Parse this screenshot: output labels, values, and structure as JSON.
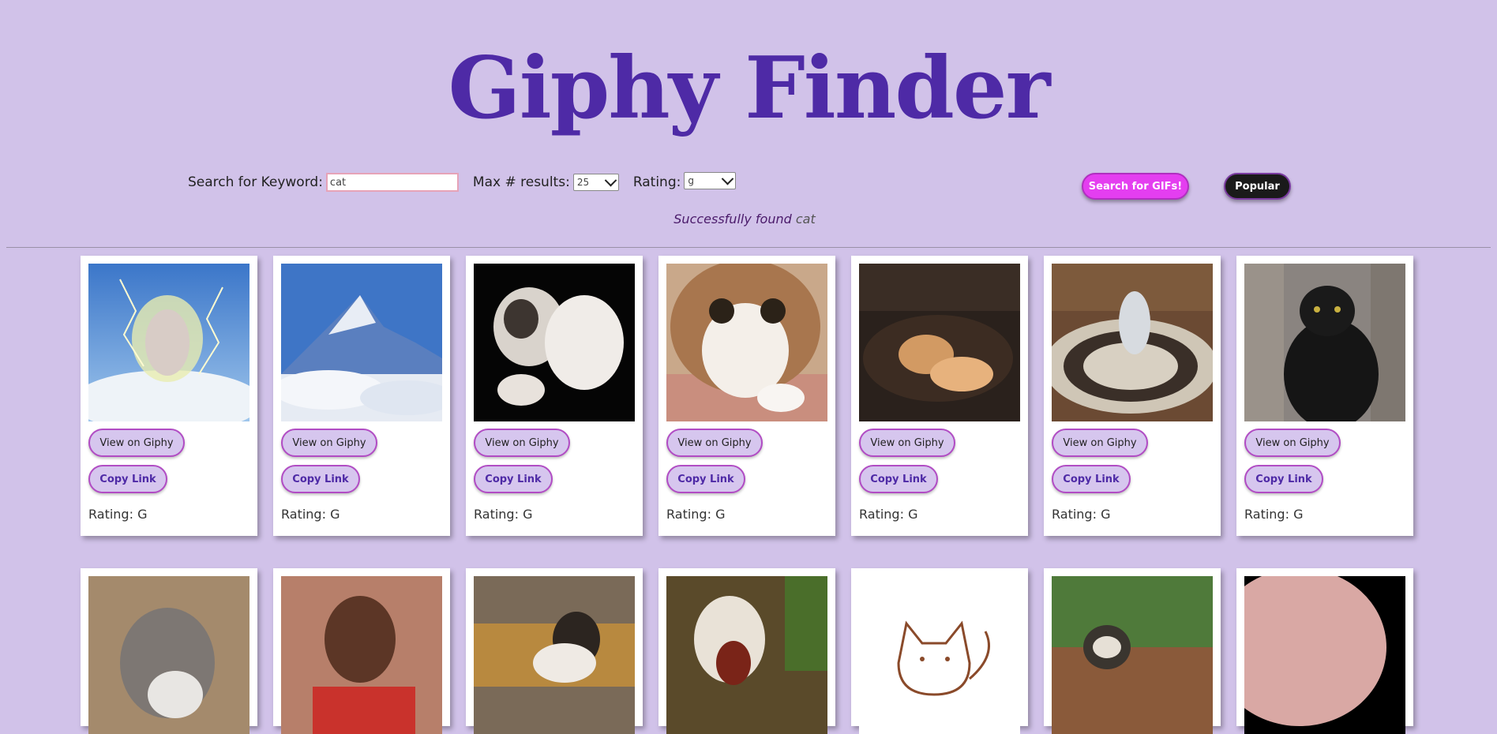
{
  "header": {
    "title": "Giphy Finder"
  },
  "search": {
    "keyword_label": "Search for Keyword:",
    "keyword_value": "cat",
    "max_label": "Max # results:",
    "max_value": "25",
    "rating_label": "Rating:",
    "rating_value": "g",
    "search_button": "Search for GIFs!",
    "popular_button": "Popular"
  },
  "status": {
    "prefix": "Successfully found",
    "term": "cat"
  },
  "card_labels": {
    "view": "View on Giphy",
    "copy": "Copy Link",
    "rating": "Rating: G"
  },
  "colors": {
    "background": "#d1c2e9",
    "title": "#4e2aa6",
    "search_button": "#e43ef0",
    "popular_button": "#1a1a1a"
  }
}
